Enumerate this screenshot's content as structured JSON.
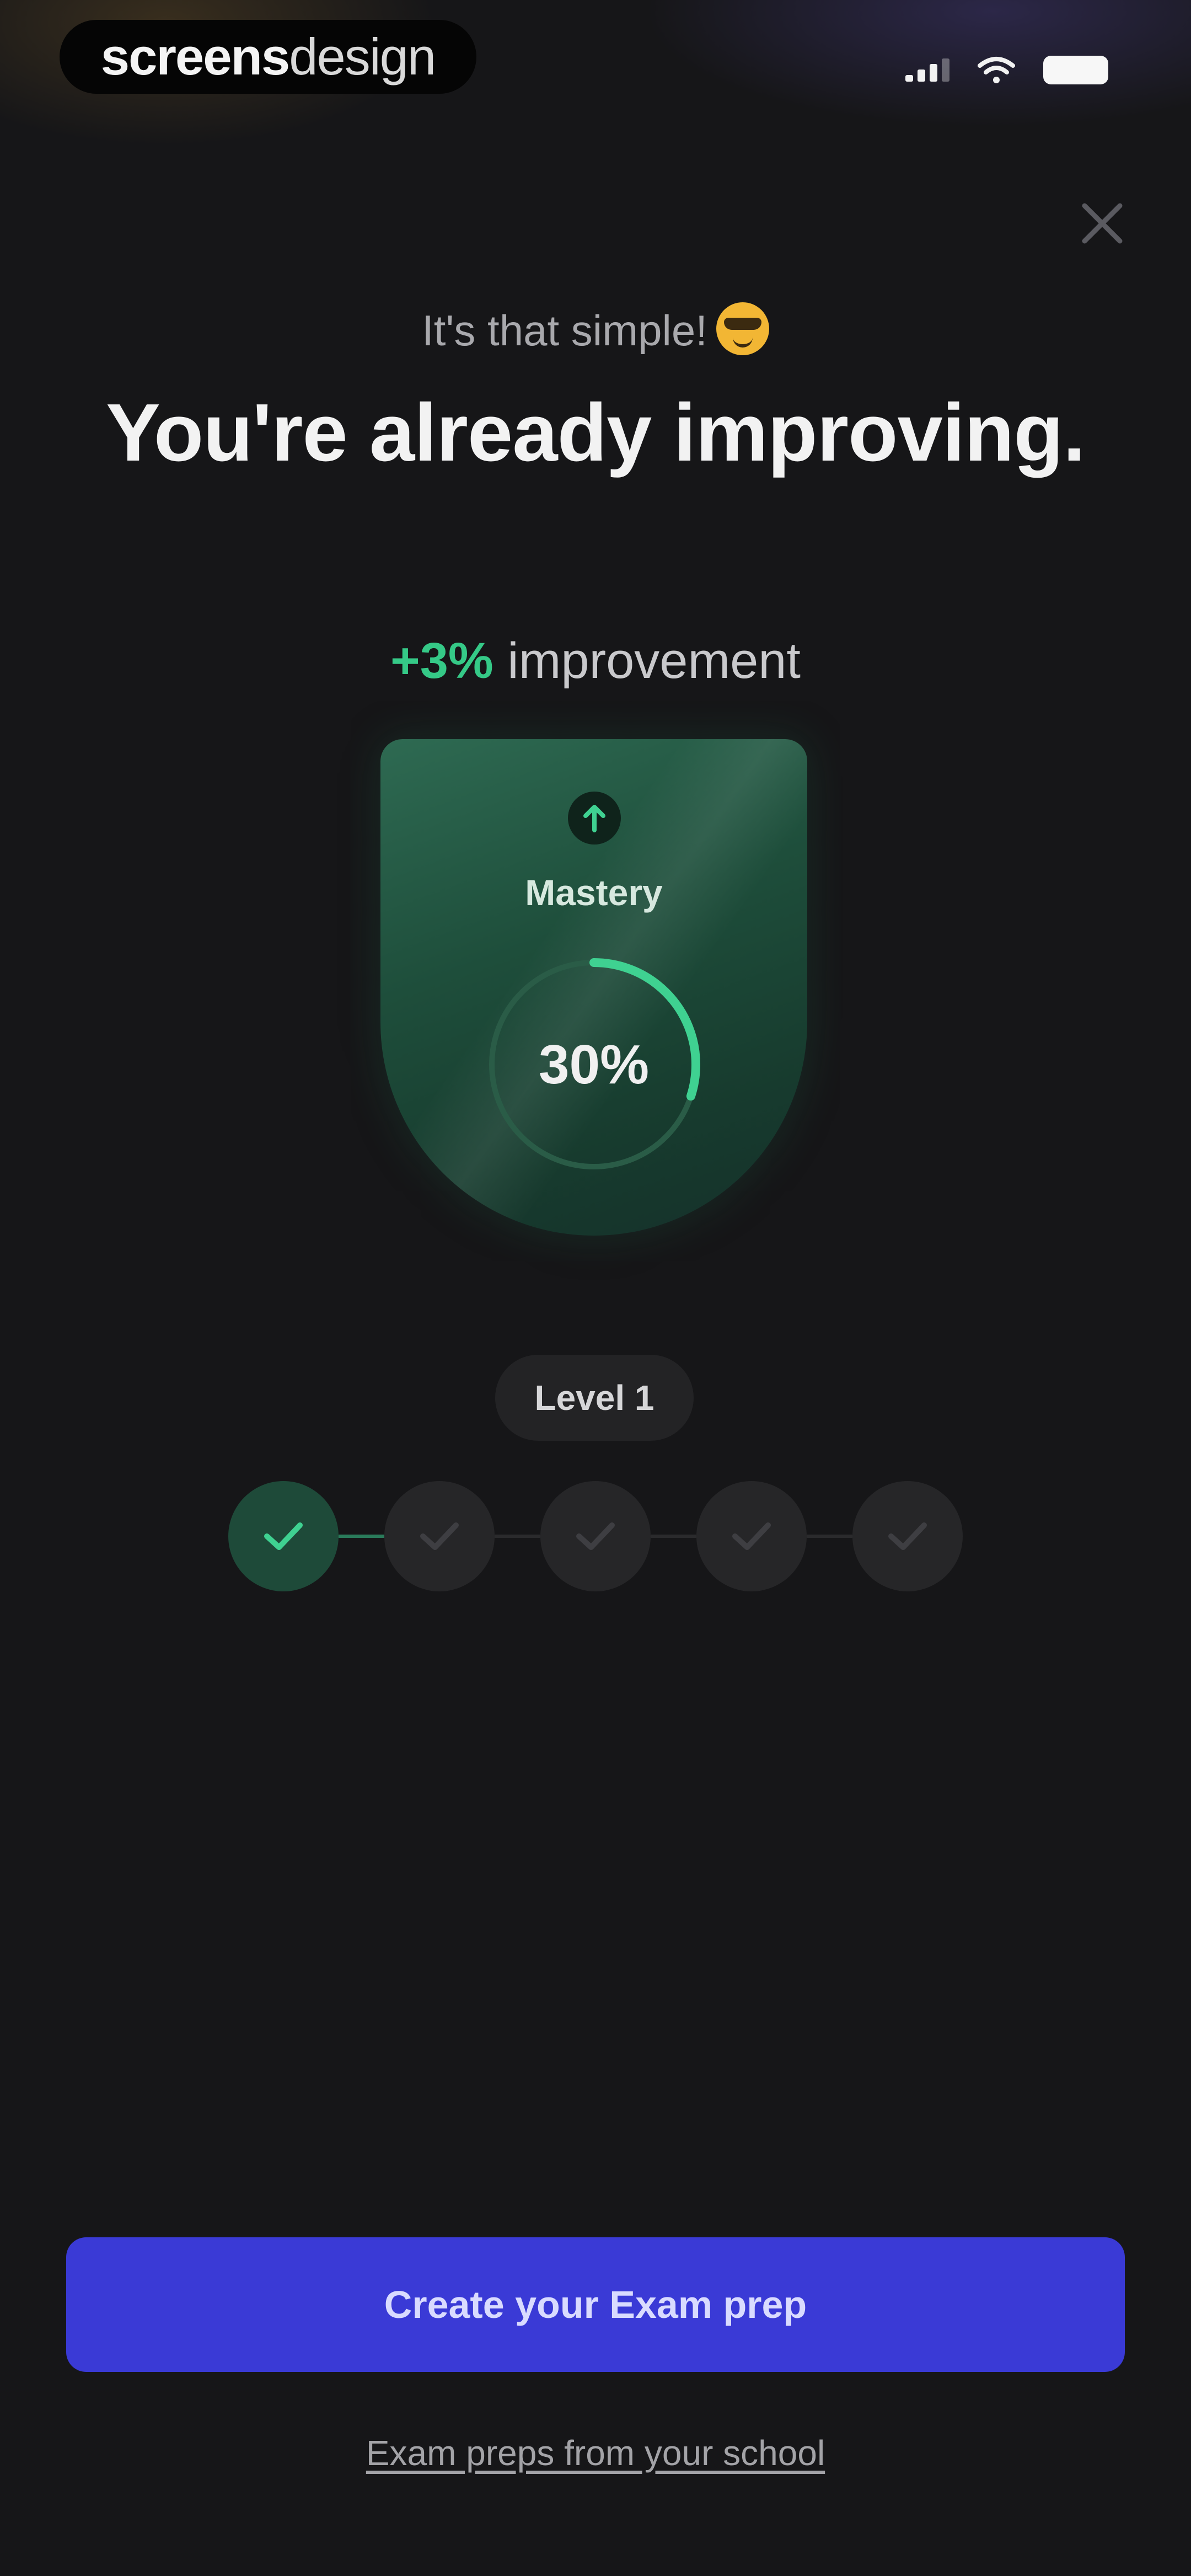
{
  "status_bar": {
    "brand_bold": "screens",
    "brand_light": "design",
    "icons": [
      "signal-icon",
      "wifi-icon",
      "battery-icon"
    ]
  },
  "header": {
    "close_icon": "close-icon",
    "subtitle": "It's that simple!",
    "subtitle_emoji": "sunglasses-face-icon",
    "title": "You're already improving."
  },
  "improvement": {
    "delta": "+3%",
    "label": "improvement"
  },
  "mastery_card": {
    "icon": "arrow-up-icon",
    "label": "Mastery",
    "value_text": "30%",
    "progress": 0.3
  },
  "level": {
    "label": "Level 1",
    "steps": [
      {
        "completed": true
      },
      {
        "completed": false
      },
      {
        "completed": false
      },
      {
        "completed": false
      },
      {
        "completed": false
      }
    ]
  },
  "actions": {
    "primary_label": "Create your Exam prep",
    "secondary_label": "Exam preps from your school"
  },
  "colors": {
    "accent_green": "#35c987",
    "button_blue": "#3a3ad6",
    "background": "#161618"
  }
}
